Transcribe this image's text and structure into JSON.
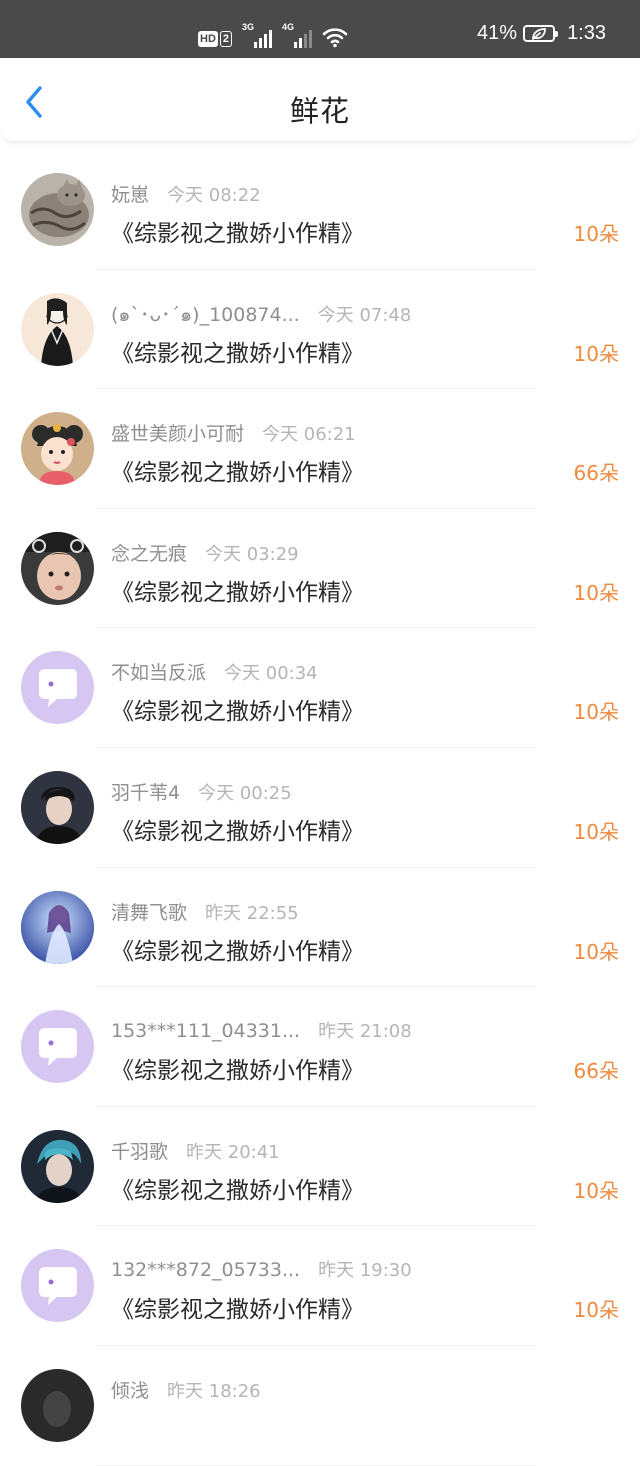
{
  "status_bar": {
    "hd_label": "HD",
    "sim_label": "2",
    "net1_label": "3G",
    "net2_label": "4G",
    "battery_pct": "41%",
    "time": "1:33",
    "icons": [
      "hd-icon",
      "signal-3g-icon",
      "signal-4g-icon",
      "wifi-icon",
      "battery-saver-icon"
    ]
  },
  "header": {
    "title": "鲜花",
    "back_icon": "chevron-left-icon",
    "accent_color": "#2a8ef0"
  },
  "colors": {
    "count_color": "#f08a3e",
    "placeholder_avatar_bg": "#d6c6f2",
    "placeholder_avatar_fg": "#9070d8"
  },
  "items": [
    {
      "user": "妧崽",
      "time": "今天 08:22",
      "book": "《综影视之撒娇小作精》",
      "count": "10朵",
      "avatar": "cat-photo"
    },
    {
      "user": "(๑`･ᴗ･´๑)_100874...",
      "time": "今天 07:48",
      "book": "《综影视之撒娇小作精》",
      "count": "10朵",
      "avatar": "sketch-girl"
    },
    {
      "user": "盛世美颜小可耐",
      "time": "今天 06:21",
      "book": "《综影视之撒娇小作精》",
      "count": "66朵",
      "avatar": "cartoon-princess"
    },
    {
      "user": "念之无痕",
      "time": "今天 03:29",
      "book": "《综影视之撒娇小作精》",
      "count": "10朵",
      "avatar": "baby-photo"
    },
    {
      "user": "不如当反派",
      "time": "今天 00:34",
      "book": "《综影视之撒娇小作精》",
      "count": "10朵",
      "avatar": "default-chat"
    },
    {
      "user": "羽千苇4",
      "time": "今天 00:25",
      "book": "《综影视之撒娇小作精》",
      "count": "10朵",
      "avatar": "boy-portrait"
    },
    {
      "user": "清舞飞歌",
      "time": "昨天 22:55",
      "book": "《综影视之撒娇小作精》",
      "count": "10朵",
      "avatar": "fantasy-girl"
    },
    {
      "user": "153***111_04331...",
      "time": "昨天 21:08",
      "book": "《综影视之撒娇小作精》",
      "count": "66朵",
      "avatar": "default-chat"
    },
    {
      "user": "千羽歌",
      "time": "昨天 20:41",
      "book": "《综影视之撒娇小作精》",
      "count": "10朵",
      "avatar": "blue-hair-boy"
    },
    {
      "user": "132***872_05733...",
      "time": "昨天 19:30",
      "book": "《综影视之撒娇小作精》",
      "count": "10朵",
      "avatar": "default-chat"
    },
    {
      "user": "倾浅",
      "time": "昨天 18:26",
      "book": "",
      "count": "",
      "avatar": "dark-portrait"
    }
  ]
}
